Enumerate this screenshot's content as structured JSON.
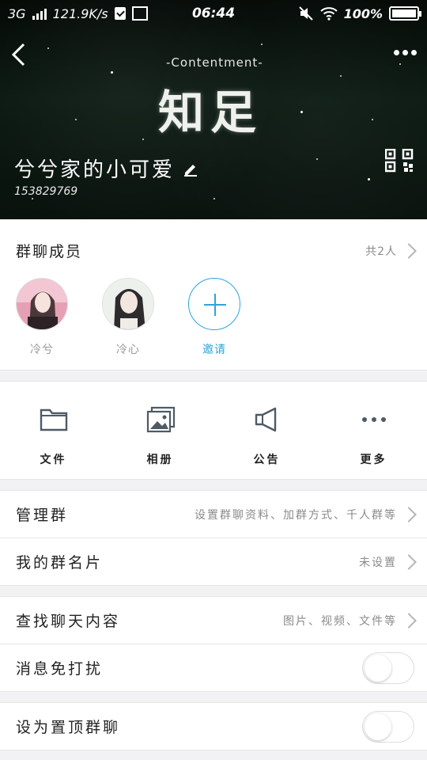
{
  "status_bar": {
    "network": "3G",
    "speed": "121.9K/s",
    "time": "06:44",
    "battery": "100%"
  },
  "header": {
    "banner_subtitle": "-Contentment-",
    "banner_title": "知足",
    "group_name": "兮兮家的小可爱",
    "group_id": "153829769"
  },
  "members": {
    "title": "群聊成员",
    "count": "共2人",
    "list": [
      {
        "name": "冷兮"
      },
      {
        "name": "冷心"
      }
    ],
    "invite_label": "邀请"
  },
  "actions": [
    {
      "label": "文件",
      "icon": "folder-icon"
    },
    {
      "label": "相册",
      "icon": "photo-album-icon"
    },
    {
      "label": "公告",
      "icon": "megaphone-icon"
    },
    {
      "label": "更多",
      "icon": "more-dots-icon"
    }
  ],
  "settings": {
    "manage_group": {
      "label": "管理群",
      "value": "设置群聊资料、加群方式、千人群等"
    },
    "my_card": {
      "label": "我的群名片",
      "value": "未设置"
    },
    "search_chat": {
      "label": "查找聊天内容",
      "value": "图片、视频、文件等"
    },
    "mute": {
      "label": "消息免打扰"
    },
    "pin": {
      "label": "设为置顶群聊"
    }
  },
  "colors": {
    "accent": "#2aa6d8",
    "header_bg": "#0b1a12"
  }
}
